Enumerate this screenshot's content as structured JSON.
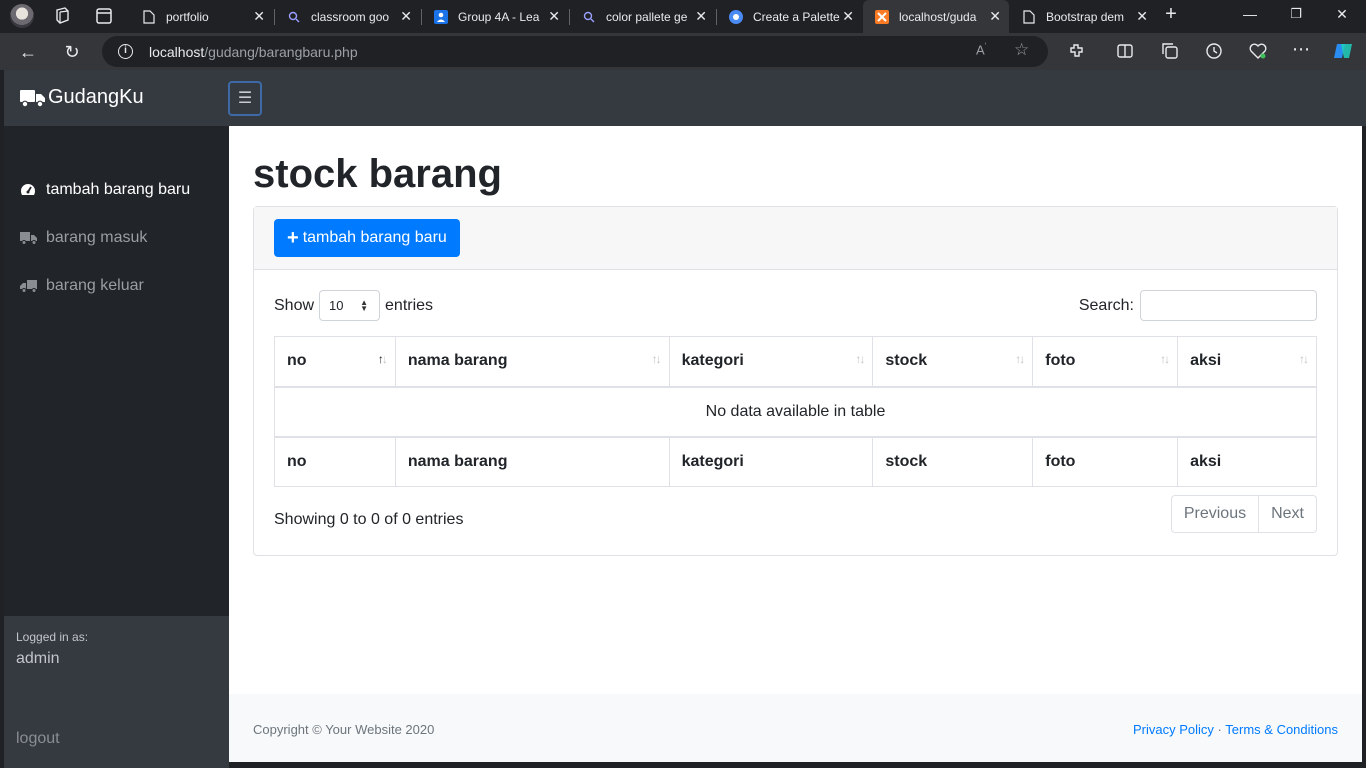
{
  "browser": {
    "tabs": [
      {
        "title": "portfolio",
        "favicon": "page-icon",
        "active": false
      },
      {
        "title": "classroom goo",
        "favicon": "search-icon",
        "active": false
      },
      {
        "title": "Group 4A - Lea",
        "favicon": "contact-icon",
        "active": false
      },
      {
        "title": "color pallete ge",
        "favicon": "search-icon",
        "active": false
      },
      {
        "title": "Create a Palette",
        "favicon": "circle-logo-icon",
        "active": false
      },
      {
        "title": "localhost/guda",
        "favicon": "xampp-icon",
        "active": true
      },
      {
        "title": "Bootstrap dem",
        "favicon": "page-icon",
        "active": false
      }
    ],
    "url_host": "localhost",
    "url_path": "/gudang/barangbaru.php"
  },
  "navbar": {
    "brand": "GudangKu",
    "toggle_icon": "☰"
  },
  "sidebar": {
    "items": [
      {
        "label": "tambah barang baru",
        "icon": "tachometer-icon"
      },
      {
        "label": "barang masuk",
        "icon": "truck-icon"
      },
      {
        "label": "barang keluar",
        "icon": "truck-icon"
      }
    ],
    "footer": {
      "logged_in_label": "Logged in as:",
      "username": "admin",
      "logout": "logout"
    }
  },
  "main": {
    "title": "stock barang",
    "add_button": "tambah barang baru",
    "length": {
      "show": "Show",
      "value": "10",
      "entries": "entries"
    },
    "search_label": "Search:",
    "table": {
      "columns": [
        "no",
        "nama barang",
        "kategori",
        "stock",
        "foto",
        "aksi"
      ],
      "empty_message": "No data available in table"
    },
    "info": "Showing 0 to 0 of 0 entries",
    "pagination": {
      "previous": "Previous",
      "next": "Next"
    }
  },
  "footer": {
    "copyright": "Copyright © Your Website 2020",
    "privacy": "Privacy Policy",
    "separator": "·",
    "terms": "Terms & Conditions"
  },
  "colors": {
    "primary": "#007bff",
    "navbar": "#343a40",
    "sidebar": "#212529"
  }
}
